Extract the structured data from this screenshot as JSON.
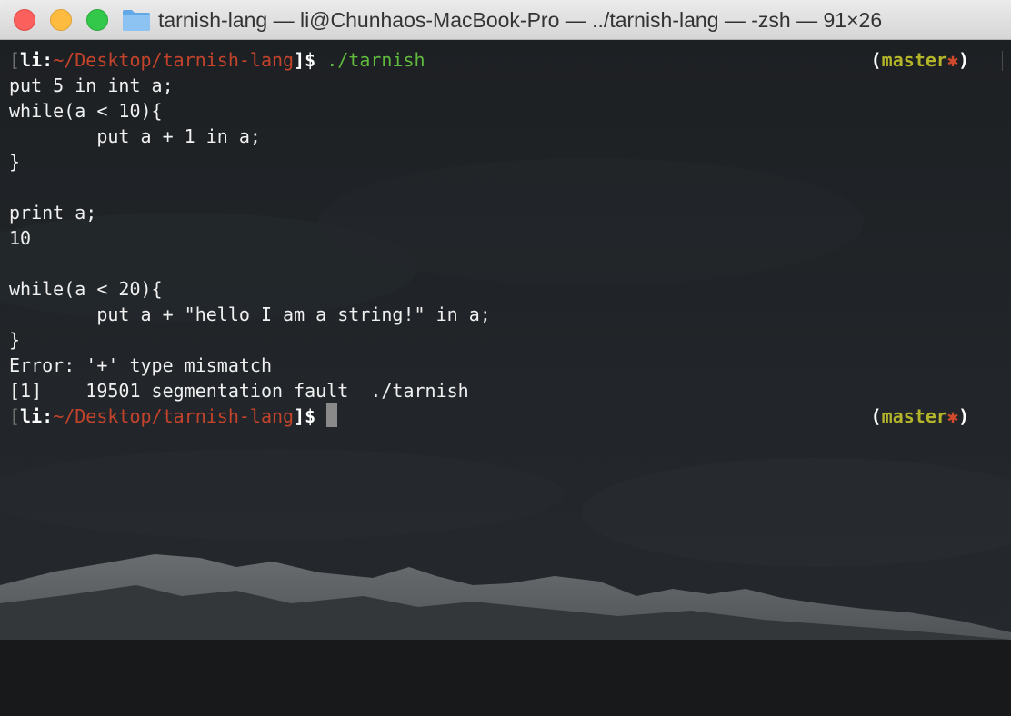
{
  "window": {
    "title": "tarnish-lang — li@Chunhaos-MacBook-Pro — ../tarnish-lang — -zsh — 91×26"
  },
  "prompt": {
    "open_bracket": "[",
    "user": "li",
    "colon": ":",
    "path": "~/Desktop/tarnish-lang",
    "close_bracket": "]$",
    "git_open": "(",
    "branch": "master",
    "dirty_mark": "✱",
    "git_close": ")"
  },
  "terminal": {
    "command": " ./tarnish",
    "output": [
      "put 5 in int a;",
      "while(a < 10){",
      "        put a + 1 in a;",
      "}",
      "",
      "print a;",
      "10",
      "",
      "while(a < 20){",
      "        put a + \"hello I am a string!\" in a;",
      "}",
      "Error: '+' type mismatch",
      "[1]    19501 segmentation fault  ./tarnish"
    ]
  },
  "colors": {
    "background": "#1c1f22",
    "path": "#c4432b",
    "command": "#5fba3d",
    "branch": "#b5b52a"
  }
}
